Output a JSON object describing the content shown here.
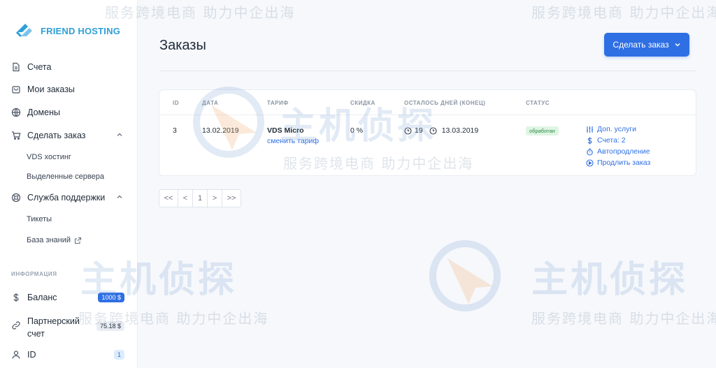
{
  "brand": {
    "name": "FRIEND HOSTING"
  },
  "sidebar": {
    "items": [
      {
        "label": "Счета",
        "icon": "file-icon"
      },
      {
        "label": "Мои заказы",
        "icon": "bag-icon"
      },
      {
        "label": "Домены",
        "icon": "globe-icon"
      },
      {
        "label": "Сделать заказ",
        "icon": "cart-icon"
      },
      {
        "label": "Служба поддержки",
        "icon": "lifebuoy-icon"
      }
    ],
    "order_sub": [
      "VDS хостинг",
      "Выделенные сервера"
    ],
    "support_sub": [
      "Тикеты",
      "База знаний"
    ],
    "info_title": "ИНФОРМАЦИЯ",
    "info": [
      {
        "label": "Баланс",
        "badge": "1000 $",
        "icon": "dollar-icon"
      },
      {
        "label": "Партнерский счет",
        "badge": "75.18 $",
        "icon": "link-icon"
      },
      {
        "label": "ID",
        "badge": "1",
        "icon": "user-icon"
      }
    ]
  },
  "main": {
    "title": "Заказы",
    "order_button": "Сделать заказ",
    "table": {
      "headers": [
        "ID",
        "ДАТА",
        "ТАРИФ",
        "СКИДКА",
        "ОСТАЛОСЬ ДНЕЙ (КОНЕЦ)",
        "СТАТУС"
      ],
      "row": {
        "id": "3",
        "date": "13.02.2019",
        "tariff": "VDS Micro",
        "change_tariff": "сменить тариф",
        "discount": "0 %",
        "days_left": "19",
        "end_date": "13.03.2019",
        "status": "обработан",
        "actions": [
          "Доп. услуги",
          "Счета: 2",
          "Автопродление",
          "Продлить заказ"
        ]
      }
    },
    "pagination": [
      "<<",
      "<",
      "1",
      ">",
      ">>"
    ]
  },
  "watermark": {
    "line": "服务跨境电商 助力中企出海",
    "big": "主机侦探"
  },
  "colors": {
    "accent": "#2f6fe4",
    "brand": "#2f9fd8",
    "status_bg": "#dff5e4"
  }
}
